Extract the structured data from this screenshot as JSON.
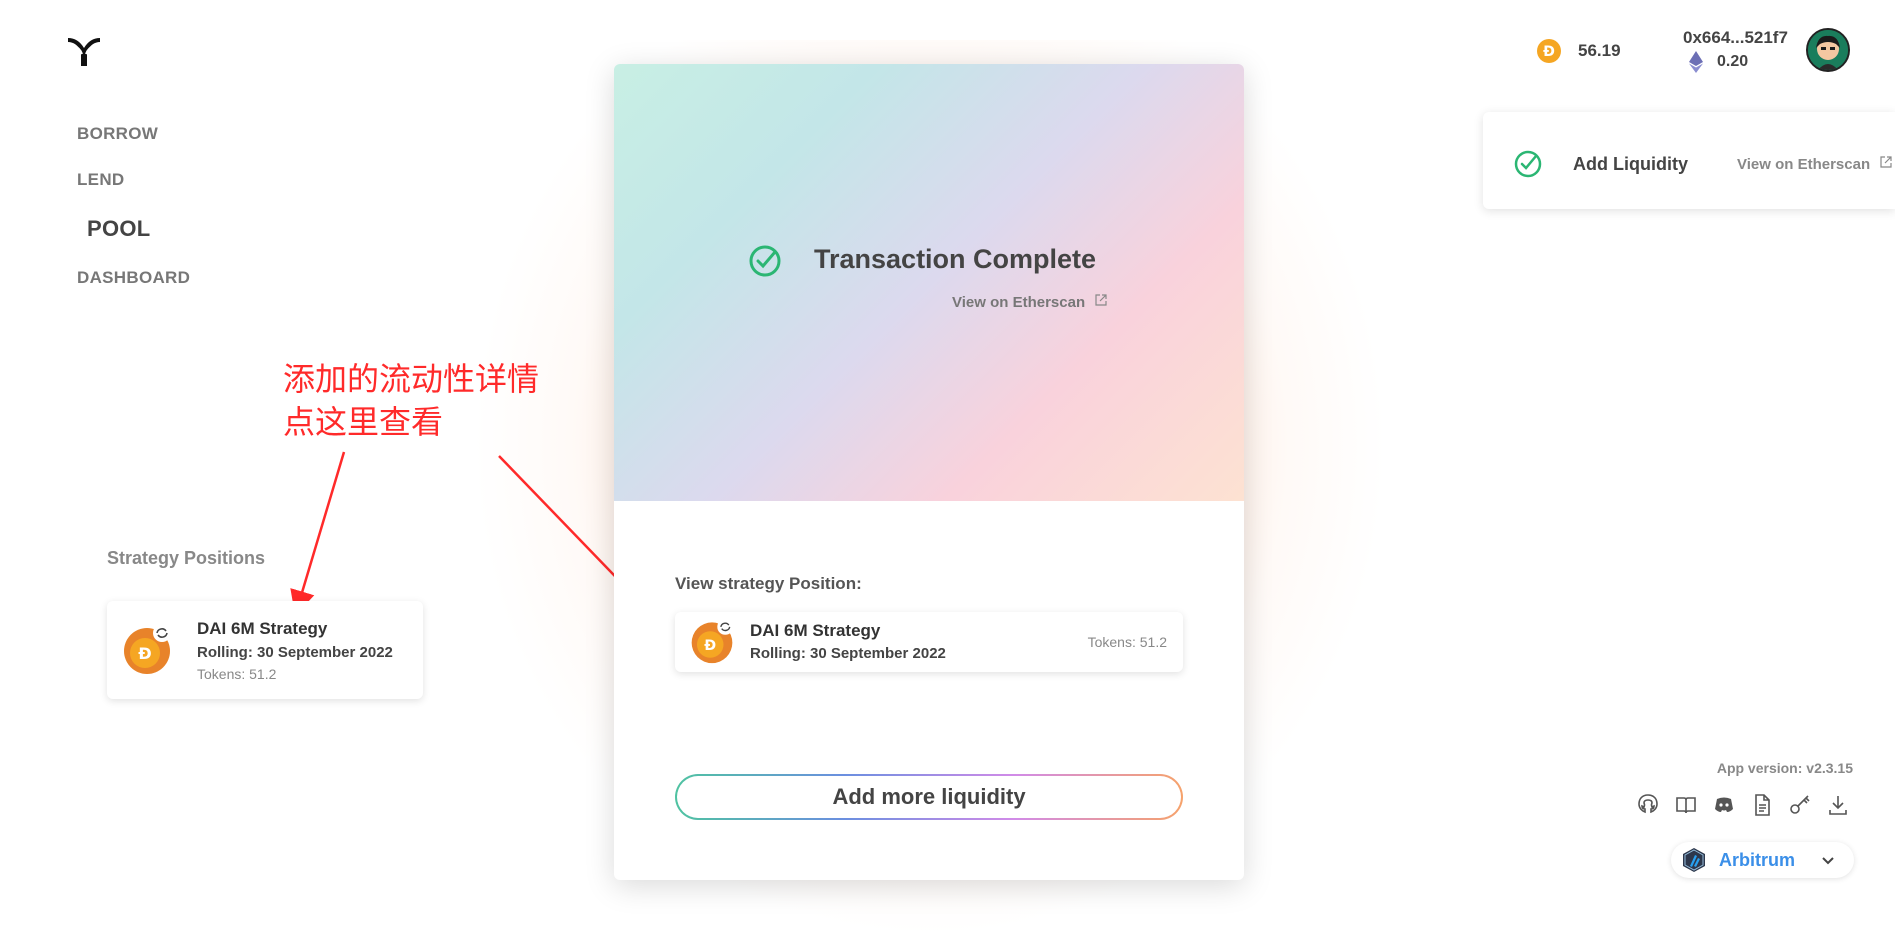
{
  "nav": {
    "items": [
      {
        "label": "BORROW",
        "active": false
      },
      {
        "label": "LEND",
        "active": false
      },
      {
        "label": "POOL",
        "active": true
      },
      {
        "label": "DASHBOARD",
        "active": false
      }
    ]
  },
  "annotation": {
    "text": "添加的流动性详情\n点这里查看",
    "color": "#ff2a2a"
  },
  "strategy_positions": {
    "label": "Strategy Positions",
    "card": {
      "name": "DAI 6M Strategy",
      "rolling": "Rolling: 30 September 2022",
      "tokens": "Tokens: 51.2"
    }
  },
  "modal": {
    "title": "Transaction Complete",
    "etherscan_link": "View on Etherscan",
    "view_position_label": "View strategy Position:",
    "position": {
      "name": "DAI 6M Strategy",
      "rolling": "Rolling: 30 September 2022",
      "tokens": "Tokens: 51.2"
    },
    "add_button": "Add more liquidity"
  },
  "header": {
    "balance": "56.19",
    "address": "0x664...521f7",
    "eth_balance": "0.20"
  },
  "toast": {
    "title": "Add Liquidity",
    "link": "View on Etherscan"
  },
  "footer": {
    "version": "App version: v2.3.15",
    "icons": [
      "github-icon",
      "book-icon",
      "discord-icon",
      "document-icon",
      "key-icon",
      "download-icon"
    ],
    "network": "Arbitrum"
  },
  "colors": {
    "accent_green": "#2bb673",
    "network_blue": "#3b8fe8",
    "dai_orange": "#f5a623"
  }
}
